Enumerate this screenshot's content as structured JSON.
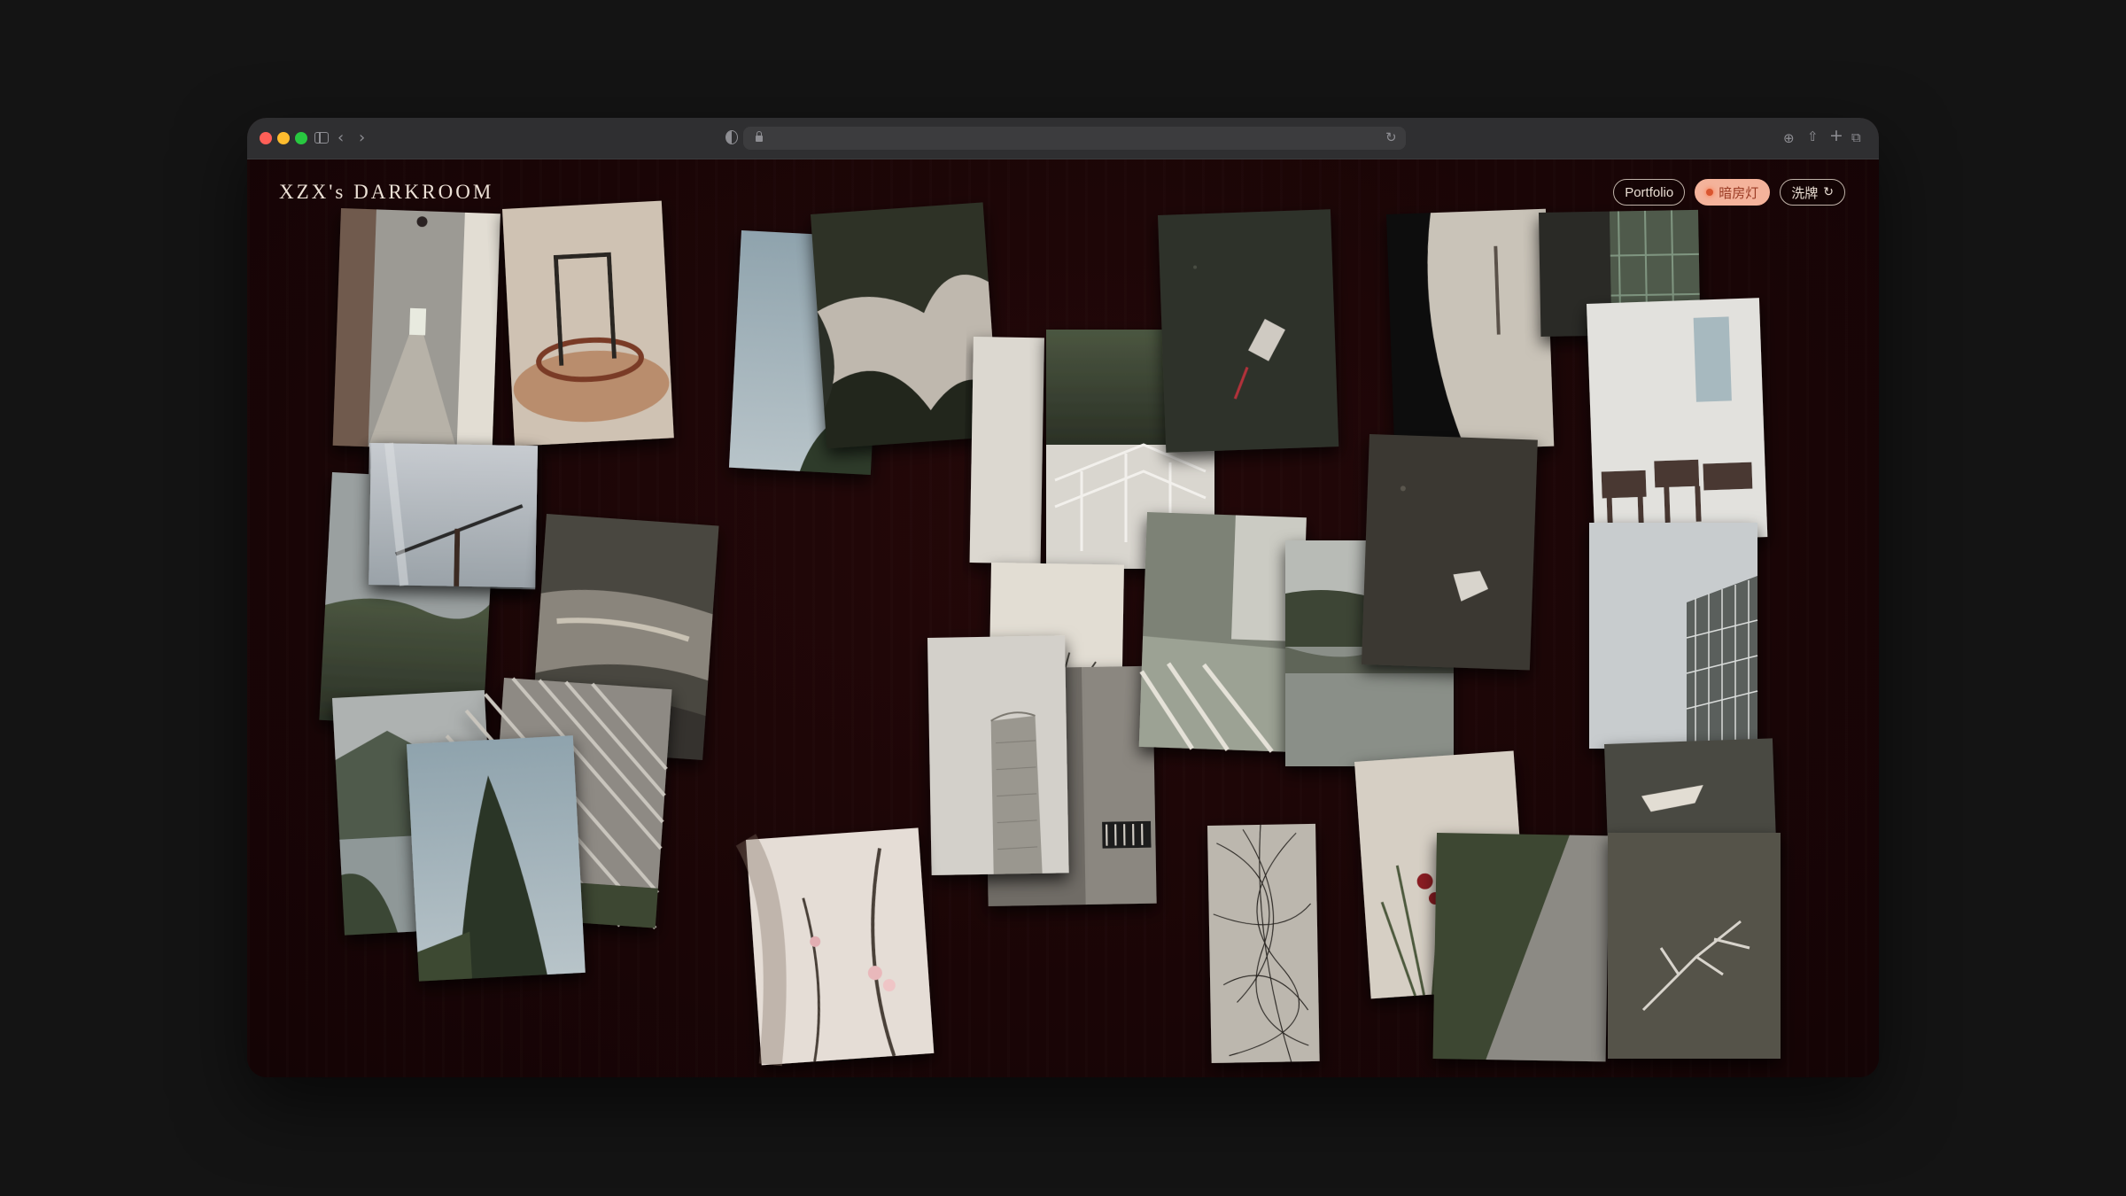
{
  "browser": {
    "url": "",
    "buttons": [
      "close",
      "minimize",
      "zoom",
      "sidebar-toggle",
      "back",
      "forward",
      "privacy",
      "reload",
      "translate",
      "share",
      "new-tab",
      "tab-overview"
    ]
  },
  "site": {
    "title": "XZX's DARKROOM",
    "nav": {
      "portfolio": "Portfolio",
      "safelight": "暗房灯",
      "shuffle": "洗牌"
    }
  },
  "colors": {
    "page_bg": "#141414",
    "darkroom_bg": "#1a0506",
    "safelight_pill": "#f4b39b",
    "safelight_text": "#9a3b24",
    "title_text": "#ece1d6"
  },
  "photos": [
    {
      "id": "corridor-arches",
      "subject": "arched corridor with hanging lamps"
    },
    {
      "id": "metal-sculpture",
      "subject": "circular sculpture with metal frame"
    },
    {
      "id": "sky-tree",
      "subject": "sky with tree branches"
    },
    {
      "id": "tree-canopy-reflection",
      "subject": "trees reflected in water"
    },
    {
      "id": "can-on-grass",
      "subject": "discarded can on grass"
    },
    {
      "id": "tree-shadow",
      "subject": "tree shadow on pavement"
    },
    {
      "id": "green-glass",
      "subject": "green glass facade"
    },
    {
      "id": "crane-sky",
      "subject": "construction crane against sky"
    },
    {
      "id": "forest-hills",
      "subject": "forested hills"
    },
    {
      "id": "river-rocks",
      "subject": "river over rocks"
    },
    {
      "id": "trees-railing",
      "subject": "trees and stair railing"
    },
    {
      "id": "stair-railing",
      "subject": "white staircase railing"
    },
    {
      "id": "dark-ground",
      "subject": "dark ground with debris"
    },
    {
      "id": "classroom",
      "subject": "classroom interior with chairs"
    },
    {
      "id": "glass-building",
      "subject": "glass building against cloudy sky"
    },
    {
      "id": "glass-corridor",
      "subject": "glass corridor with shadows"
    },
    {
      "id": "lake-reflection",
      "subject": "lake reflecting trees"
    },
    {
      "id": "bare-branches",
      "subject": "bare branches against sky"
    },
    {
      "id": "tower-building",
      "subject": "tall tower building"
    },
    {
      "id": "stone-wall",
      "subject": "stone wall with vent"
    },
    {
      "id": "mountain-lake",
      "subject": "mountain and lake"
    },
    {
      "id": "stripe-facade",
      "subject": "striped building facade"
    },
    {
      "id": "cypress-tree",
      "subject": "tall cypress tree"
    },
    {
      "id": "blossom-branch",
      "subject": "blossoming branch"
    },
    {
      "id": "tangled-wires",
      "subject": "tangled wires"
    },
    {
      "id": "red-flowers",
      "subject": "red flowering plant"
    },
    {
      "id": "green-wall-corner",
      "subject": "green wall and concrete corner"
    },
    {
      "id": "rooftop-sign",
      "subject": "rooftop with sign"
    },
    {
      "id": "dry-branch-ground",
      "subject": "dry branch on ground"
    }
  ]
}
